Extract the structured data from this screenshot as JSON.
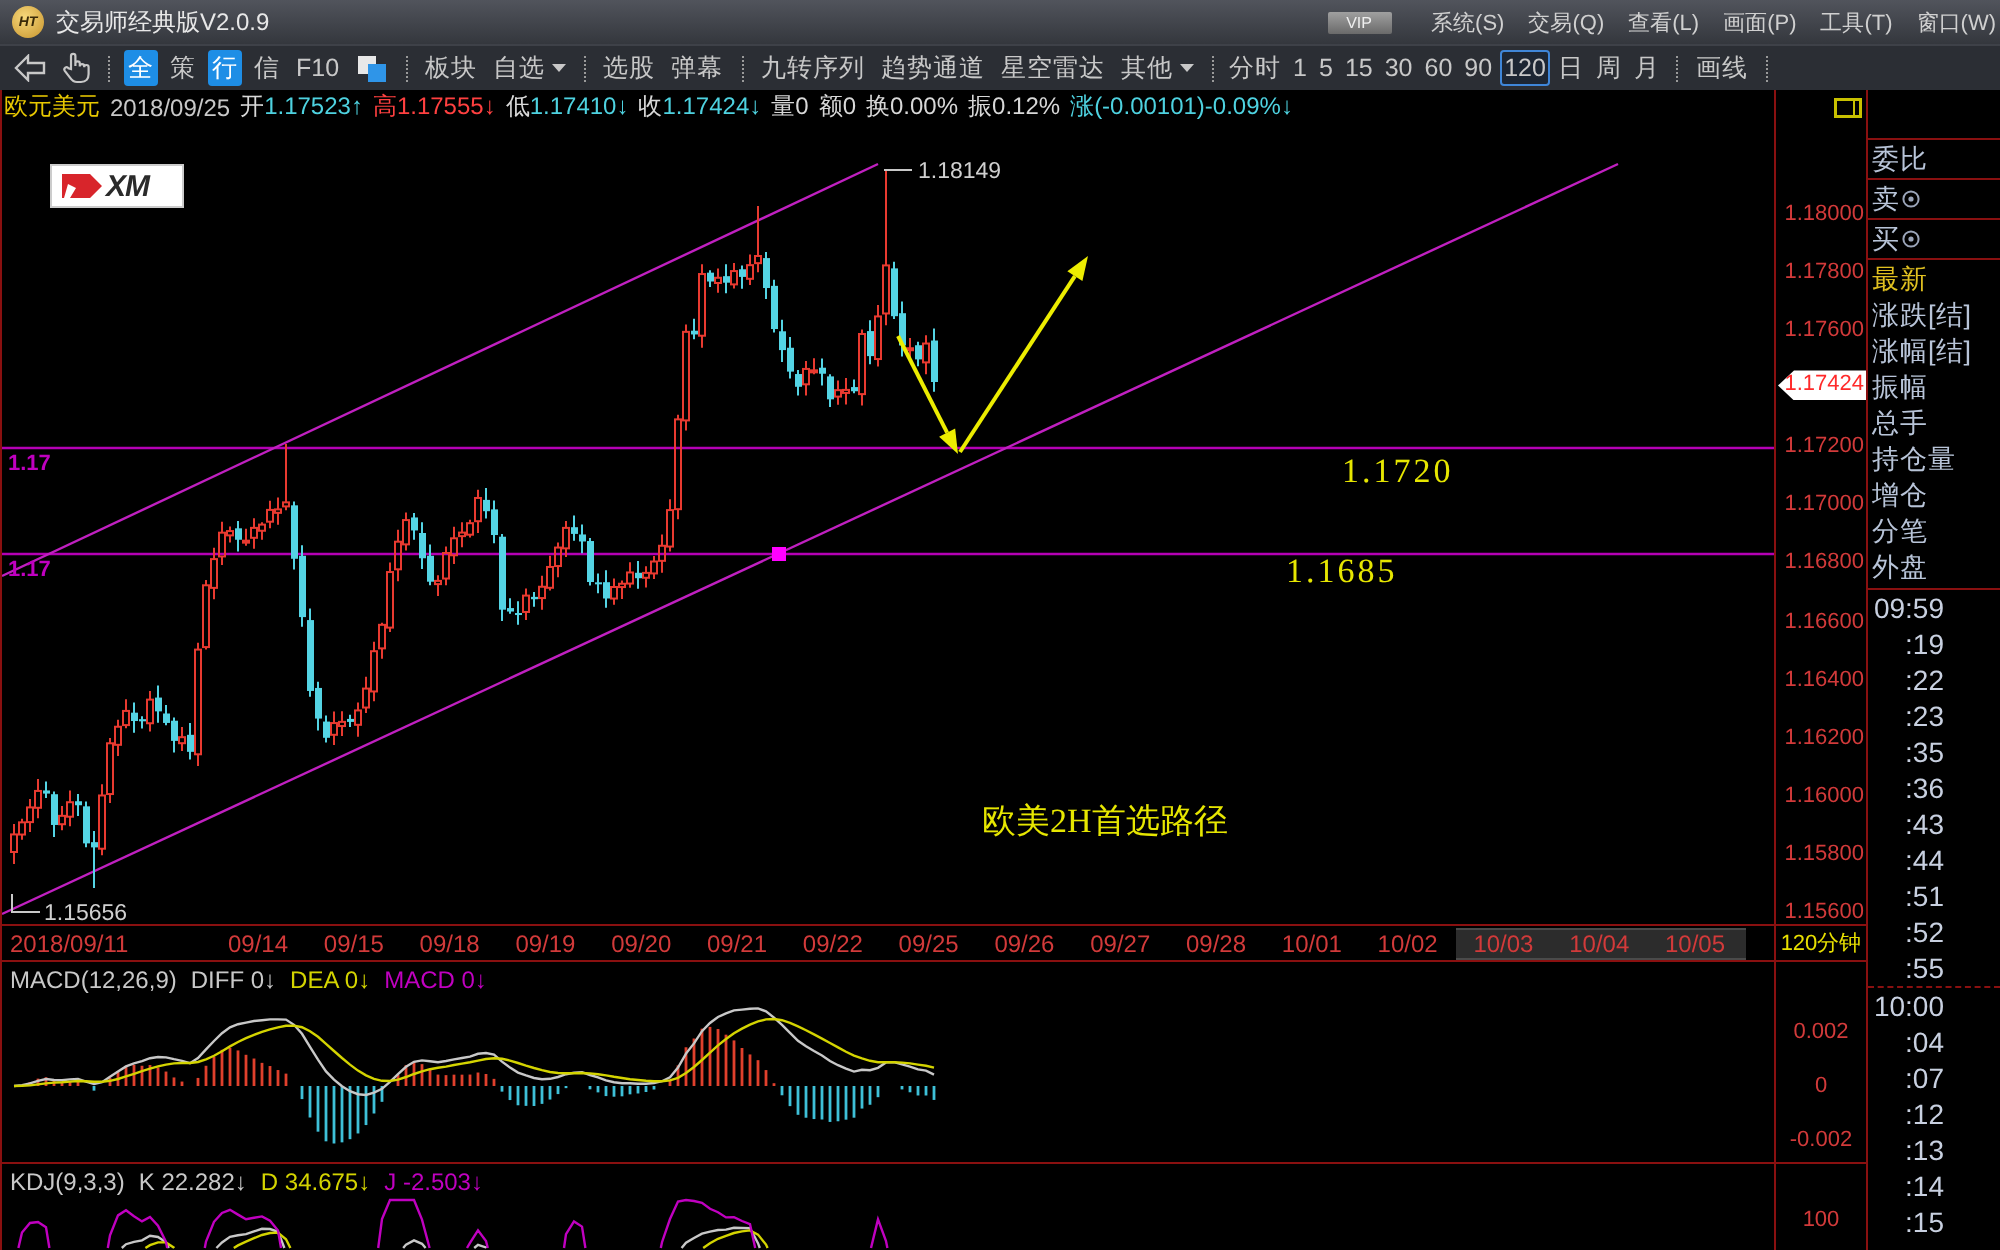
{
  "window": {
    "logo_text": "HT",
    "title": "交易师经典版V2.0.9",
    "badge": "VIP",
    "menus": [
      "系统(S)",
      "交易(Q)",
      "查看(L)",
      "画面(P)",
      "工具(T)",
      "窗口(W)"
    ]
  },
  "toolbar": {
    "quick": [
      {
        "label": "全",
        "selected": true
      },
      {
        "label": "策",
        "selected": false
      },
      {
        "label": "行",
        "selected": true
      },
      {
        "label": "信",
        "selected": false
      },
      {
        "label": "F10",
        "selected": false
      }
    ],
    "groups": [
      [
        {
          "label": "板块",
          "dropdown": false
        },
        {
          "label": "自选",
          "dropdown": true
        }
      ],
      [
        {
          "label": "选股",
          "dropdown": false
        },
        {
          "label": "弹幕",
          "dropdown": false
        }
      ],
      [
        {
          "label": "九转序列",
          "dropdown": false
        },
        {
          "label": "趋势通道",
          "dropdown": false
        },
        {
          "label": "星空雷达",
          "dropdown": false
        },
        {
          "label": "其他",
          "dropdown": true
        }
      ]
    ],
    "periods": [
      {
        "label": "分时",
        "selected": false
      },
      {
        "label": "1",
        "selected": false
      },
      {
        "label": "5",
        "selected": false
      },
      {
        "label": "15",
        "selected": false
      },
      {
        "label": "30",
        "selected": false
      },
      {
        "label": "60",
        "selected": false
      },
      {
        "label": "90",
        "selected": false
      },
      {
        "label": "120",
        "selected": true
      },
      {
        "label": "日",
        "selected": false
      },
      {
        "label": "周",
        "selected": false
      },
      {
        "label": "月",
        "selected": false
      }
    ],
    "draw_tool": "画线"
  },
  "quote": {
    "symbol": "欧元美元",
    "date": "2018/09/25",
    "fields": [
      {
        "parts": [
          {
            "text": "开",
            "color": "#d8d8d8"
          },
          {
            "text": "1.17523↑",
            "color": "#4ed2e0"
          }
        ]
      },
      {
        "parts": [
          {
            "text": "高",
            "color": "#ff4040"
          },
          {
            "text": "1.17555↓",
            "color": "#ff4040"
          }
        ]
      },
      {
        "parts": [
          {
            "text": "低",
            "color": "#d8d8d8"
          },
          {
            "text": "1.17410↓",
            "color": "#4ed2e0"
          }
        ]
      },
      {
        "parts": [
          {
            "text": "收",
            "color": "#d8d8d8"
          },
          {
            "text": "1.17424↓",
            "color": "#4ed2e0"
          }
        ]
      },
      {
        "parts": [
          {
            "text": "量",
            "color": "#d8d8d8"
          },
          {
            "text": "0",
            "color": "#d8d8d8"
          }
        ]
      },
      {
        "parts": [
          {
            "text": "额",
            "color": "#d8d8d8"
          },
          {
            "text": "0",
            "color": "#d8d8d8"
          }
        ]
      },
      {
        "parts": [
          {
            "text": "换",
            "color": "#d8d8d8"
          },
          {
            "text": "0.00%",
            "color": "#d8d8d8"
          }
        ]
      },
      {
        "parts": [
          {
            "text": "振",
            "color": "#d8d8d8"
          },
          {
            "text": "0.12%",
            "color": "#d8d8d8"
          }
        ]
      },
      {
        "parts": [
          {
            "text": "涨",
            "color": "#4ed2e0"
          },
          {
            "text": "(-0.00101)-0.09%↓",
            "color": "#4ed2e0"
          }
        ]
      }
    ]
  },
  "chart": {
    "broker_logo": "XM",
    "high_label": "1.18149",
    "low_label": "1.15656",
    "levels": [
      {
        "axis_label": "1.17",
        "note": "1.1720"
      },
      {
        "axis_label": "1.17",
        "note": "1.1685"
      }
    ],
    "caption": "欧美2H首选路径",
    "price_ticks": [
      {
        "label": "1.18000",
        "kind": "tick"
      },
      {
        "label": "1.17800",
        "kind": "tick"
      },
      {
        "label": "1.17600",
        "kind": "tick"
      },
      {
        "label": "1.17424",
        "kind": "last"
      },
      {
        "label": "1.17200",
        "kind": "tick"
      },
      {
        "label": "1.17000",
        "kind": "tick"
      },
      {
        "label": "1.16800",
        "kind": "tick"
      },
      {
        "label": "1.16600",
        "kind": "tick"
      },
      {
        "label": "1.16400",
        "kind": "tick"
      },
      {
        "label": "1.16200",
        "kind": "tick"
      },
      {
        "label": "1.16000",
        "kind": "tick"
      },
      {
        "label": "1.15800",
        "kind": "tick"
      },
      {
        "label": "1.15600",
        "kind": "tick"
      }
    ],
    "period": "120分钟",
    "dates": [
      {
        "label": "2018/09/11",
        "highlighted": false
      },
      {
        "label": "09/14",
        "highlighted": false
      },
      {
        "label": "09/15",
        "highlighted": false
      },
      {
        "label": "09/18",
        "highlighted": false
      },
      {
        "label": "09/19",
        "highlighted": false
      },
      {
        "label": "09/20",
        "highlighted": false
      },
      {
        "label": "09/21",
        "highlighted": false
      },
      {
        "label": "09/22",
        "highlighted": false
      },
      {
        "label": "09/25",
        "highlighted": false
      },
      {
        "label": "09/26",
        "highlighted": false
      },
      {
        "label": "09/27",
        "highlighted": false
      },
      {
        "label": "09/28",
        "highlighted": false
      },
      {
        "label": "10/01",
        "highlighted": false
      },
      {
        "label": "10/02",
        "highlighted": false
      },
      {
        "label": "10/03",
        "highlighted": true
      },
      {
        "label": "10/04",
        "highlighted": true
      },
      {
        "label": "10/05",
        "highlighted": true
      }
    ]
  },
  "macd": {
    "title": "MACD(12,26,9)",
    "values": [
      {
        "label": "DIFF",
        "value": "0↓",
        "color": "#c8c8c8"
      },
      {
        "label": "DEA",
        "value": "0↓",
        "color": "#d4d400"
      },
      {
        "label": "MACD",
        "value": "0↓",
        "color": "#c000c0"
      }
    ],
    "ticks": [
      "0.002",
      "0",
      "-0.002"
    ]
  },
  "kdj": {
    "title": "KDJ(9,3,3)",
    "values": [
      {
        "label": "K",
        "value": "22.282↓",
        "color": "#c8c8c8"
      },
      {
        "label": "D",
        "value": "34.675↓",
        "color": "#d4d400"
      },
      {
        "label": "J",
        "value": "-2.503↓",
        "color": "#c000c0"
      }
    ],
    "ticks": [
      "100"
    ]
  },
  "side_panel": {
    "order_rows": [
      {
        "label": "委比",
        "kind": "ratio"
      },
      {
        "label": "卖",
        "kind": "order"
      },
      {
        "label": "买",
        "kind": "order"
      }
    ],
    "fields": [
      {
        "label": "最新",
        "color": "#e0c020"
      },
      {
        "label": "涨跌[结]",
        "color": "#b8c4d8"
      },
      {
        "label": "涨幅[结]",
        "color": "#b8c4d8"
      },
      {
        "label": "振幅",
        "color": "#b8c4d8"
      },
      {
        "label": "总手",
        "color": "#b8c4d8"
      },
      {
        "label": "持仓量",
        "color": "#b8c4d8"
      },
      {
        "label": "增仓",
        "color": "#b8c4d8"
      },
      {
        "label": "分笔",
        "color": "#b8c4d8"
      },
      {
        "label": "外盘",
        "color": "#b8c4d8"
      }
    ],
    "tick_groups": [
      [
        "09:59",
        ":19",
        ":22",
        ":23",
        ":35",
        ":36",
        ":43",
        ":44",
        ":51",
        ":52",
        ":55"
      ],
      [
        "10:00",
        ":04",
        ":07",
        ":12",
        ":13",
        ":14",
        ":15"
      ]
    ]
  }
}
